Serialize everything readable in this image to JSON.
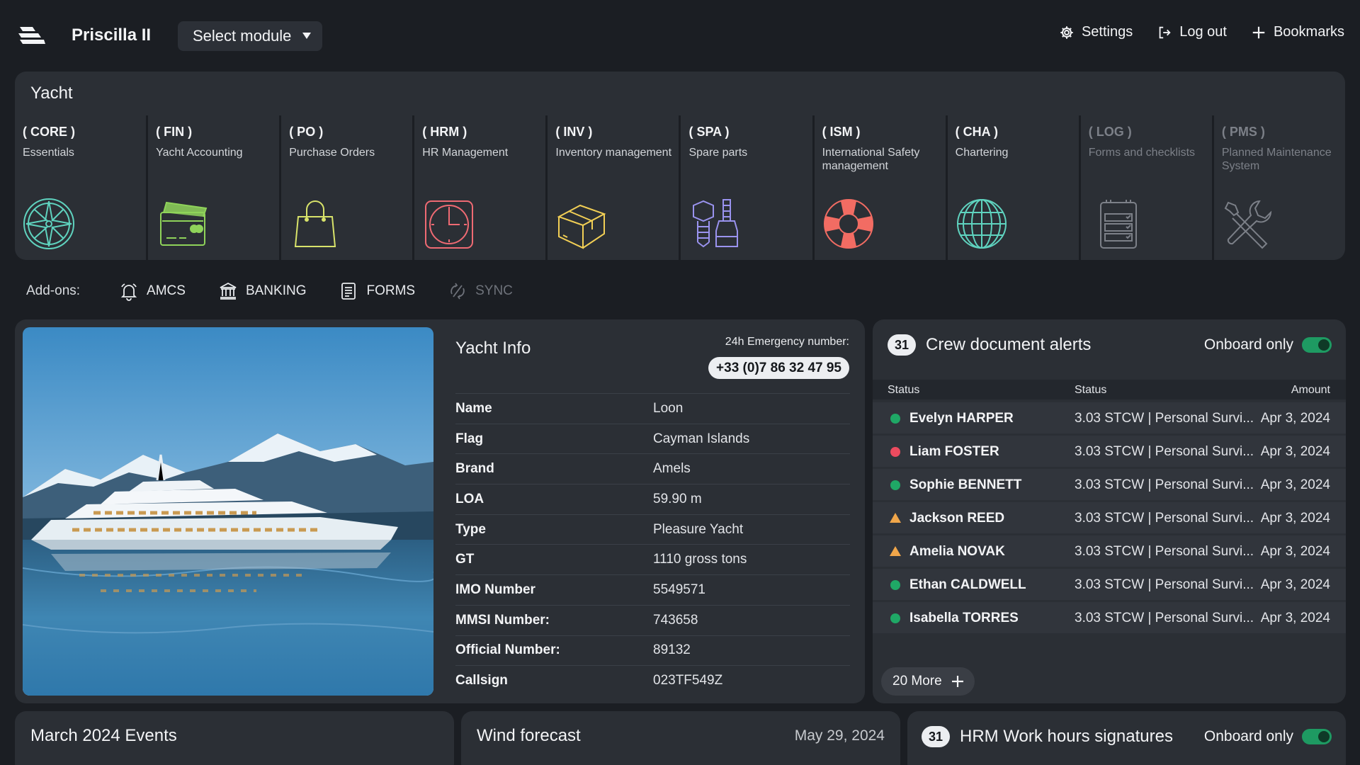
{
  "app": {
    "title": "Priscilla II",
    "module_select": "Select module"
  },
  "top_actions": {
    "settings": "Settings",
    "logout": "Log out",
    "bookmarks": "Bookmarks"
  },
  "yacht_panel": {
    "title": "Yacht",
    "modules": [
      {
        "code": "( CORE )",
        "desc": "Essentials",
        "icon": "compass-rose-icon",
        "color": "#5fd3bf",
        "enabled": true
      },
      {
        "code": "( FIN )",
        "desc": "Yacht Accounting",
        "icon": "wallet-card-icon",
        "color": "#8fd35a",
        "enabled": true
      },
      {
        "code": "( PO )",
        "desc": "Purchase Orders",
        "icon": "shopping-bag-icon",
        "color": "#d8e36a",
        "enabled": true
      },
      {
        "code": "( HRM )",
        "desc": "HR Management",
        "icon": "clock-icon",
        "color": "#ef6a73",
        "enabled": true
      },
      {
        "code": "( INV )",
        "desc": "Inventory management",
        "icon": "box-icon",
        "color": "#f2cf55",
        "enabled": true
      },
      {
        "code": "( SPA )",
        "desc": "Spare parts",
        "icon": "bolt-parts-icon",
        "color": "#9a93ef",
        "enabled": true
      },
      {
        "code": "( ISM )",
        "desc": "International Safety management",
        "icon": "lifebuoy-icon",
        "color": "#f26c63",
        "enabled": true
      },
      {
        "code": "( CHA )",
        "desc": "Chartering",
        "icon": "globe-icon",
        "color": "#5fd3bf",
        "enabled": true
      },
      {
        "code": "( LOG )",
        "desc": "Forms and checklists",
        "icon": "clipboard-checklist-icon",
        "color": "#7c8088",
        "enabled": false
      },
      {
        "code": "( PMS )",
        "desc": "Planned Maintenance System",
        "icon": "wrench-screwdriver-icon",
        "color": "#7c8088",
        "enabled": false
      }
    ]
  },
  "addons": {
    "label": "Add-ons:",
    "items": [
      {
        "label": "AMCS",
        "icon": "bell-icon",
        "enabled": true
      },
      {
        "label": "BANKING",
        "icon": "bank-icon",
        "enabled": true
      },
      {
        "label": "FORMS",
        "icon": "document-icon",
        "enabled": true
      },
      {
        "label": "SYNC",
        "icon": "sync-icon",
        "enabled": false
      }
    ]
  },
  "yacht_info": {
    "title": "Yacht Info",
    "emergency_label": "24h Emergency number:",
    "emergency_number": "+33 (0)7 86 32 47 95",
    "rows": [
      {
        "k": "Name",
        "v": "Loon"
      },
      {
        "k": "Flag",
        "v": "Cayman Islands"
      },
      {
        "k": "Brand",
        "v": "Amels"
      },
      {
        "k": "LOA",
        "v": "59.90 m"
      },
      {
        "k": "Type",
        "v": "Pleasure Yacht"
      },
      {
        "k": "GT",
        "v": "1110 gross tons"
      },
      {
        "k": "IMO Number",
        "v": "5549571"
      },
      {
        "k": "MMSI Number:",
        "v": "743658"
      },
      {
        "k": "Official Number:",
        "v": "89132"
      },
      {
        "k": "Callsign",
        "v": "023TF549Z"
      }
    ]
  },
  "crew_alerts": {
    "count": "31",
    "title": "Crew document alerts",
    "onboard_label": "Onboard only",
    "columns": [
      "Status",
      "Status",
      "Amount"
    ],
    "rows": [
      {
        "status": "green",
        "name": "Evelyn HARPER",
        "doc": "3.03 STCW | Personal Survi...",
        "date": "Apr 3, 2024"
      },
      {
        "status": "red",
        "name": "Liam FOSTER",
        "doc": "3.03 STCW | Personal Survi...",
        "date": "Apr 3, 2024"
      },
      {
        "status": "green",
        "name": "Sophie BENNETT",
        "doc": "3.03 STCW | Personal Survi...",
        "date": "Apr 3, 2024"
      },
      {
        "status": "warning",
        "name": "Jackson REED",
        "doc": "3.03 STCW | Personal Survi...",
        "date": "Apr 3, 2024"
      },
      {
        "status": "warning",
        "name": "Amelia NOVAK",
        "doc": "3.03 STCW | Personal Survi...",
        "date": "Apr 3, 2024"
      },
      {
        "status": "green",
        "name": "Ethan CALDWELL",
        "doc": "3.03 STCW | Personal Survi...",
        "date": "Apr 3, 2024"
      },
      {
        "status": "green",
        "name": "Isabella TORRES",
        "doc": "3.03 STCW | Personal Survi...",
        "date": "Apr 3, 2024"
      }
    ],
    "more_label": "20 More"
  },
  "bottom": {
    "events_title": "March 2024 Events",
    "wind_title": "Wind forecast",
    "wind_date": "May 29, 2024",
    "hrm_count": "31",
    "hrm_title": "HRM Work hours signatures",
    "hrm_onboard_label": "Onboard only"
  },
  "colors": {
    "status_green": "#1fa866",
    "status_red": "#ec4b5f",
    "status_warning": "#f0a64a",
    "toggle_on": "#1e9a62"
  }
}
